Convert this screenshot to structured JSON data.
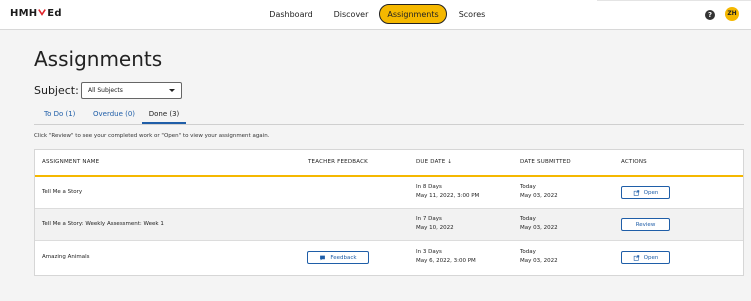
{
  "header": {
    "logo_text_left": "HMH",
    "logo_text_right": "Ed",
    "nav": [
      "Dashboard",
      "Discover",
      "Assignments",
      "Scores"
    ],
    "avatar_initials": "ZH",
    "help_symbol": "?"
  },
  "page": {
    "title": "Assignments",
    "subject_label": "Subject:",
    "subject_value": "All Subjects",
    "tabs": [
      "To Do (1)",
      "Overdue (0)",
      "Done (3)"
    ],
    "hint": "Click \"Review\" to see your completed work or \"Open\" to view your assignment again."
  },
  "table": {
    "headers": [
      "ASSIGNMENT NAME",
      "TEACHER FEEDBACK",
      "DUE DATE ↓",
      "DATE SUBMITTED",
      "ACTIONS"
    ],
    "rows": [
      {
        "name": "Tell Me a Story",
        "feedback": "",
        "due_line1": "In 8 Days",
        "due_line2": "May 11, 2022, 3:00 PM",
        "sub_line1": "Today",
        "sub_line2": "May 03, 2022",
        "action": "Open"
      },
      {
        "name": "Tell Me a Story: Weekly Assessment: Week 1",
        "feedback": "",
        "due_line1": "In 7 Days",
        "due_line2": "May 10, 2022",
        "sub_line1": "Today",
        "sub_line2": "May 03, 2022",
        "action": "Review"
      },
      {
        "name": "Amazing Animals",
        "feedback": "Feedback",
        "due_line1": "In 3 Days",
        "due_line2": "May 6, 2022, 3:00 PM",
        "sub_line1": "Today",
        "sub_line2": "May 03, 2022",
        "action": "Open"
      }
    ]
  },
  "colors": {
    "accent": "#f5b800",
    "link": "#1f5ea8",
    "logo_red": "#e0242b"
  },
  "icons": [
    "hmh-logo-check-icon",
    "help-icon",
    "caret-down-icon",
    "open-external-icon",
    "feedback-icon"
  ]
}
